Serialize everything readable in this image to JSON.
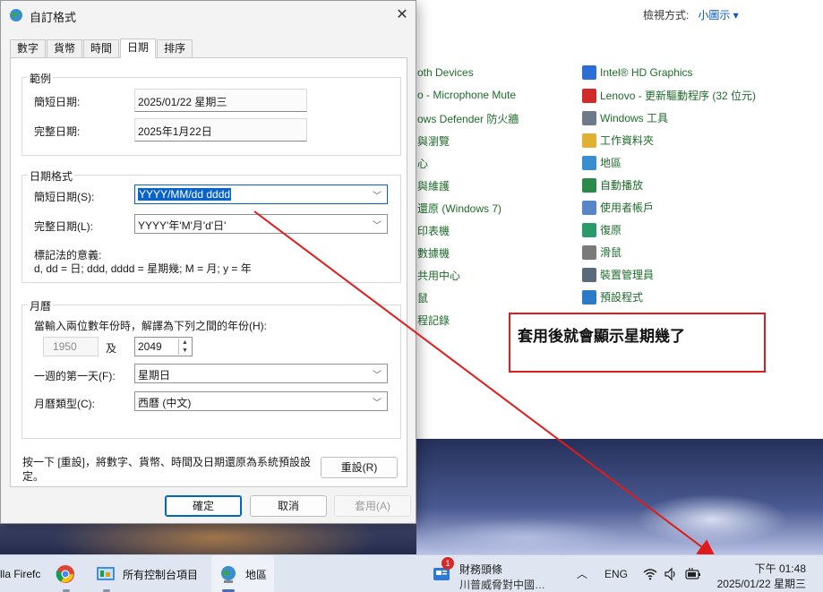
{
  "dialog": {
    "title": "自訂格式",
    "close": "✕",
    "tabs": [
      "數字",
      "貨幣",
      "時間",
      "日期",
      "排序"
    ],
    "active_tab": "日期",
    "example": {
      "title": "範例",
      "short_label": "簡短日期:",
      "short_value": "2025/01/22 星期三",
      "long_label": "完整日期:",
      "long_value": "2025年1月22日"
    },
    "date_format": {
      "title": "日期格式",
      "short_label": "簡短日期(S):",
      "short_value": "YYYY/MM/dd dddd",
      "long_label": "完整日期(L):",
      "long_value": "YYYY'年'M'月'd'日'",
      "notation_title": "標記法的意義:",
      "notation_text": "d, dd = 日;  ddd, dddd = 星期幾;  M = 月;  y = 年"
    },
    "calendar": {
      "title": "月曆",
      "two_digit_label": "當輸入兩位數年份時，解譯為下列之間的年份(H):",
      "year_from": "1950",
      "and": "及",
      "year_to": "2049",
      "first_day_label": "一週的第一天(F):",
      "first_day_value": "星期日",
      "type_label": "月曆類型(C):",
      "type_value": "西曆 (中文)"
    },
    "reset_text": "按一下 [重設]，將數字、貨幣、時間及日期還原為系統預設設定。",
    "reset_button": "重設(R)",
    "ok_button": "確定",
    "cancel_button": "取消",
    "apply_button": "套用(A)"
  },
  "control_panel": {
    "view_label": "檢視方式:",
    "view_value": "小圖示 ▾",
    "left_items": [
      "oth Devices",
      "o - Microphone Mute",
      "ows Defender 防火牆",
      "與瀏覽",
      "心",
      "與維護",
      "還原 (Windows 7)",
      "印表機",
      "數據機",
      "共用中心",
      "鼠",
      "程記錄"
    ],
    "right_items": [
      "Intel® HD Graphics",
      "Lenovo - 更新驅動程序 (32 位元)",
      "Windows 工具",
      "工作資料夾",
      "地區",
      "自動播放",
      "使用者帳戶",
      "復原",
      "滑鼠",
      "裝置管理員",
      "預設程式"
    ],
    "right_icon_colors": [
      "#2b6fd6",
      "#d12a2a",
      "#6c7a8a",
      "#e0b030",
      "#3a8ed0",
      "#2a8a4a",
      "#5a84c8",
      "#2a9a6a",
      "#7a7a7a",
      "#5a6a7a",
      "#2a7ac8"
    ]
  },
  "annotation": {
    "text": "套用後就會顯示星期幾了",
    "color": "#e01b1b"
  },
  "taskbar": {
    "firefox_label": "lla Firefc",
    "cp_label": "所有控制台項目",
    "map_label": "地區",
    "news_badge": "1",
    "news_title": "財務頭條",
    "news_subtitle": "川普威脅對中國…",
    "chevron": "︿",
    "lang": "ENG",
    "time": "下午 01:48",
    "date": "2025/01/22 星期三"
  }
}
